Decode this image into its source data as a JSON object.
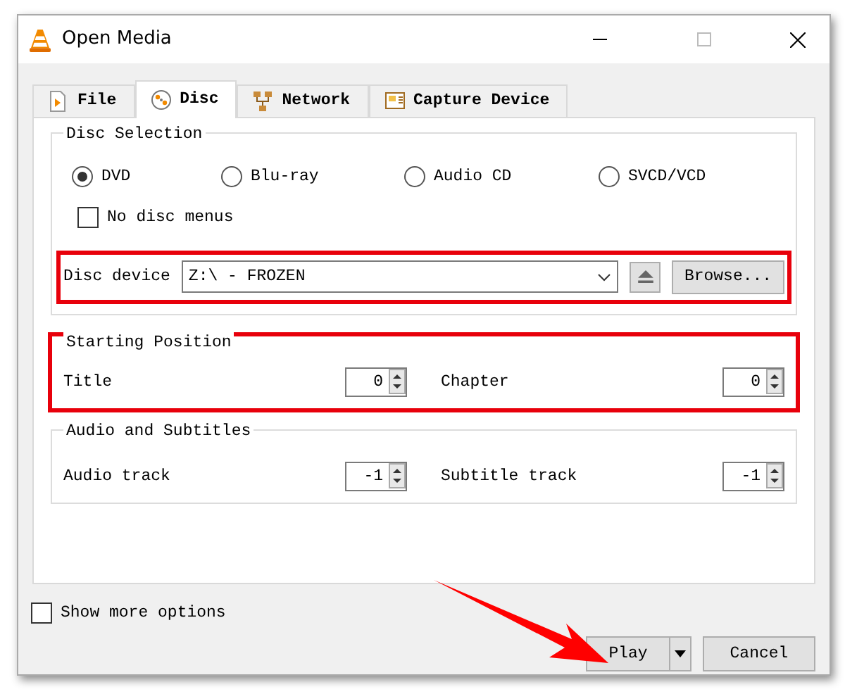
{
  "window": {
    "title": "Open Media"
  },
  "tabs": [
    {
      "label": "File",
      "selected": false
    },
    {
      "label": "Disc",
      "selected": true
    },
    {
      "label": "Network",
      "selected": false
    },
    {
      "label": "Capture Device",
      "selected": false
    }
  ],
  "disc_selection": {
    "title": "Disc Selection",
    "disc_types": [
      {
        "label": "DVD",
        "selected": true
      },
      {
        "label": "Blu-ray",
        "selected": false
      },
      {
        "label": "Audio CD",
        "selected": false
      },
      {
        "label": "SVCD/VCD",
        "selected": false
      }
    ],
    "no_disc_menus": {
      "label": "No disc menus",
      "checked": false
    },
    "disc_device": {
      "label": "Disc device",
      "value": "Z:\\ - FROZEN",
      "browse": "Browse...",
      "highlighted": true
    }
  },
  "starting_position": {
    "title": "Starting Position",
    "highlighted": true,
    "fields": [
      {
        "label": "Title",
        "value": "0"
      },
      {
        "label": "Chapter",
        "value": "0"
      }
    ]
  },
  "audio_subtitles": {
    "title": "Audio and Subtitles",
    "fields": [
      {
        "label": "Audio track",
        "value": "-1"
      },
      {
        "label": "Subtitle track",
        "value": "-1"
      }
    ]
  },
  "show_more_options": {
    "label": "Show more options",
    "checked": false
  },
  "buttons": {
    "play": "Play",
    "cancel": "Cancel"
  },
  "annotation_arrow": true
}
